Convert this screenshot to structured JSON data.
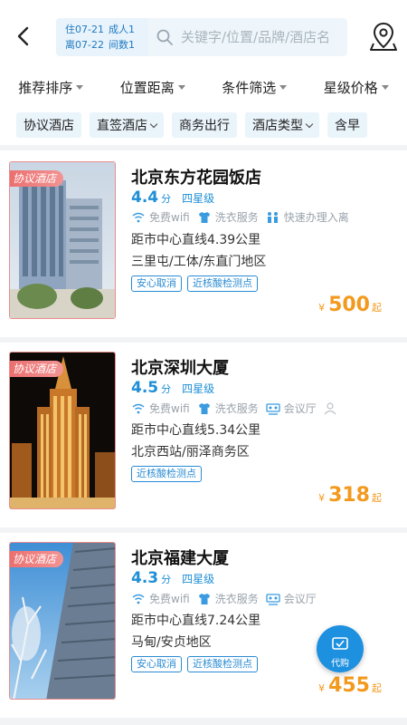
{
  "header": {
    "checkin_label": "住07-21",
    "checkout_label": "离07-22",
    "adults_label": "成人1",
    "rooms_label": "间数1",
    "search_placeholder": "关键字/位置/品牌/酒店名"
  },
  "sort_bar": [
    {
      "label": "推荐排序"
    },
    {
      "label": "位置距离"
    },
    {
      "label": "条件筛选"
    },
    {
      "label": "星级价格"
    }
  ],
  "tags": [
    {
      "label": "协议酒店",
      "has_chevron": false
    },
    {
      "label": "直签酒店",
      "has_chevron": true
    },
    {
      "label": "商务出行",
      "has_chevron": false
    },
    {
      "label": "酒店类型",
      "has_chevron": true
    },
    {
      "label": "含早",
      "has_chevron": false
    }
  ],
  "hotels": [
    {
      "ribbon": "协议酒店",
      "name": "北京东方花园饭店",
      "score": "4.4",
      "score_unit": "分",
      "star": "四星级",
      "amenities": [
        "免费wifi",
        "洗衣服务",
        "快速办理入离"
      ],
      "distance": "距市中心直线4.39公里",
      "area": "三里屯/工体/东直门地区",
      "badges": [
        "安心取消",
        "近核酸检测点"
      ],
      "currency": "¥",
      "price": "500",
      "price_suffix": "起"
    },
    {
      "ribbon": "协议酒店",
      "name": "北京深圳大厦",
      "score": "4.5",
      "score_unit": "分",
      "star": "四星级",
      "amenities": [
        "免费wifi",
        "洗衣服务",
        "会议厅"
      ],
      "distance": "距市中心直线5.34公里",
      "area": "北京西站/丽泽商务区",
      "badges": [
        "近核酸检测点"
      ],
      "currency": "¥",
      "price": "318",
      "price_suffix": "起"
    },
    {
      "ribbon": "协议酒店",
      "name": "北京福建大厦",
      "score": "4.3",
      "score_unit": "分",
      "star": "四星级",
      "amenities": [
        "免费wifi",
        "洗衣服务",
        "会议厅"
      ],
      "distance": "距市中心直线7.24公里",
      "area": "马甸/安贞地区",
      "badges": [
        "安心取消",
        "近核酸检测点"
      ],
      "currency": "¥",
      "price": "455",
      "price_suffix": "起"
    }
  ],
  "floating_button": {
    "label": "代购"
  },
  "colors": {
    "accent": "#1f8fd6",
    "price": "#f39a1e",
    "ribbon": "#ec6f6f"
  }
}
